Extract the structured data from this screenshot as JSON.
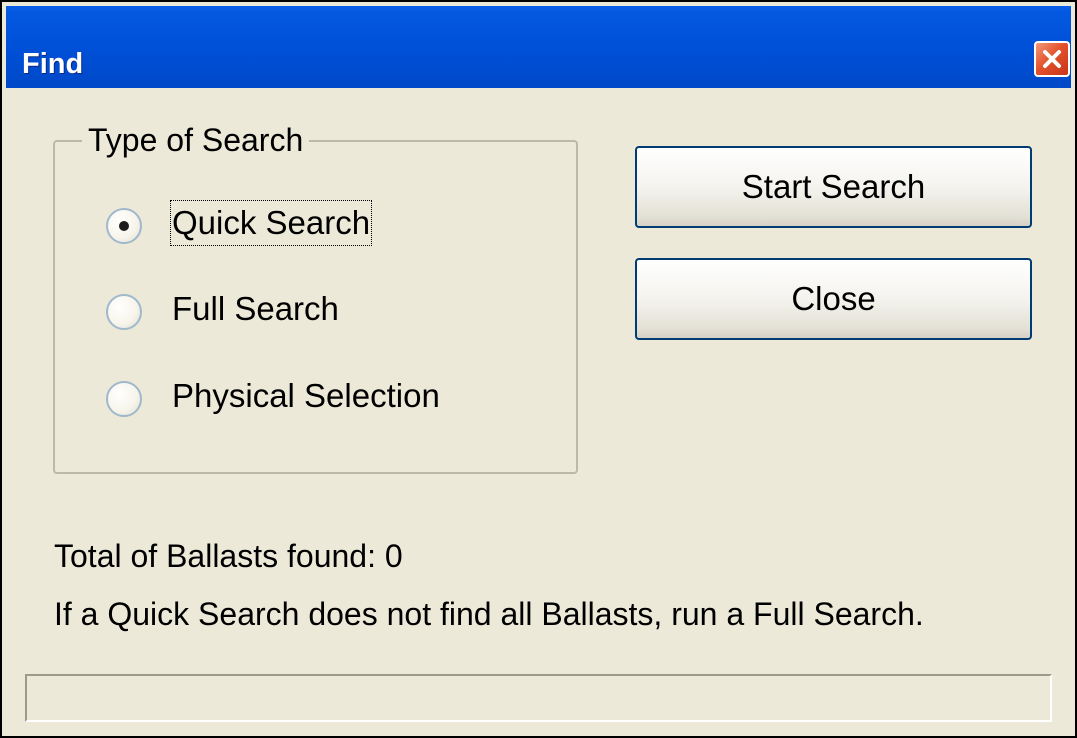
{
  "window": {
    "title": "Find",
    "close_icon": "close-icon"
  },
  "search_type": {
    "group_label": "Type of Search",
    "options": [
      {
        "label": "Quick Search",
        "selected": true
      },
      {
        "label": "Full Search",
        "selected": false
      },
      {
        "label": "Physical Selection",
        "selected": false
      }
    ]
  },
  "buttons": {
    "start_search": "Start Search",
    "close": "Close"
  },
  "results": {
    "total_text": "Total of Ballasts found:  0",
    "hint_text": "If a Quick Search does not find all Ballasts, run a Full Search."
  },
  "status_bar": {
    "text": ""
  },
  "colors": {
    "title_bar": "#0050d8",
    "dialog_background": "#ece9d8",
    "close_button": "#e3532b",
    "button_border": "#003c74"
  }
}
